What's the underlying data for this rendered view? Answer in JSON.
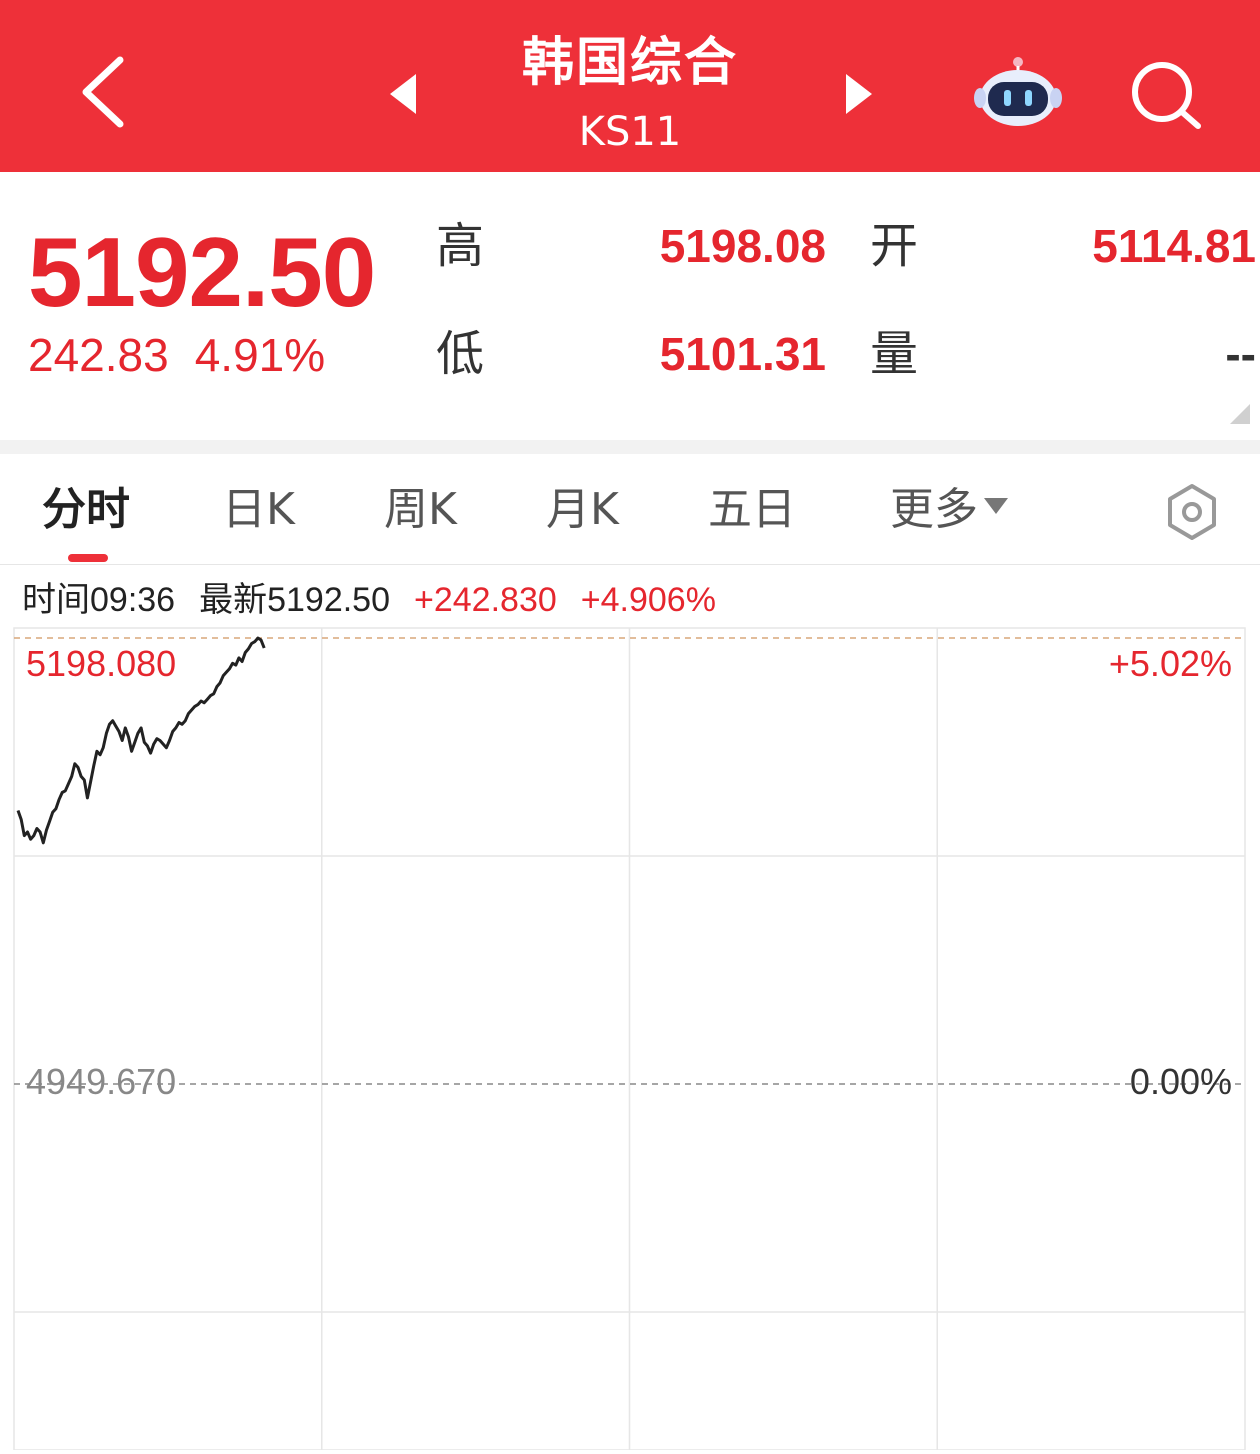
{
  "header": {
    "title": "韩国综合",
    "code": "KS11",
    "icons": {
      "back": "chevron-left-icon",
      "prev": "triangle-left-icon",
      "next": "triangle-right-icon",
      "assistant": "robot-icon",
      "search": "search-icon"
    }
  },
  "quote": {
    "price": "5192.50",
    "change": "242.83",
    "change_pct": "4.91%",
    "high_label": "高",
    "high": "5198.08",
    "open_label": "开",
    "open": "5114.81",
    "low_label": "低",
    "low": "5101.31",
    "volume_label": "量",
    "volume": "--"
  },
  "tabs": [
    "分时",
    "日K",
    "周K",
    "月K",
    "五日",
    "更多"
  ],
  "active_tab": "分时",
  "info": {
    "time": "时间09:36",
    "latest": "最新5192.50",
    "change": "+242.830",
    "change_pct": "+4.906%"
  },
  "colors": {
    "header": "#EE3039",
    "up": "#E5262E",
    "line": "#222222",
    "ref": "#888888"
  },
  "chart_data": {
    "type": "line",
    "y_left_labels": {
      "top": "5198.080",
      "ref": "4949.670"
    },
    "y_right_labels": {
      "top": "+5.02%",
      "ref": "0.00%"
    },
    "ylim": [
      4700.0,
      5198.08
    ],
    "ref_value": 4949.67,
    "trading_minutes": 390,
    "grid": true,
    "series": [
      {
        "values": [
          5102,
          5097,
          5088,
          5090,
          5086,
          5088,
          5092,
          5090,
          5084,
          5091,
          5096,
          5101,
          5103,
          5108,
          5112,
          5113,
          5117,
          5121,
          5128,
          5126,
          5121,
          5119,
          5109,
          5118,
          5127,
          5135,
          5133,
          5137,
          5145,
          5150,
          5152,
          5149,
          5146,
          5141,
          5148,
          5143,
          5135,
          5140,
          5145,
          5148,
          5140,
          5138,
          5134,
          5139,
          5142,
          5141,
          5139,
          5137,
          5141,
          5146,
          5148,
          5151,
          5150,
          5152,
          5156,
          5158,
          5160,
          5161,
          5163,
          5162,
          5164,
          5166,
          5167,
          5171,
          5173,
          5177,
          5179,
          5181,
          5184,
          5183,
          5187,
          5185,
          5190,
          5192,
          5195,
          5196,
          5198,
          5197,
          5192.5
        ]
      }
    ]
  }
}
